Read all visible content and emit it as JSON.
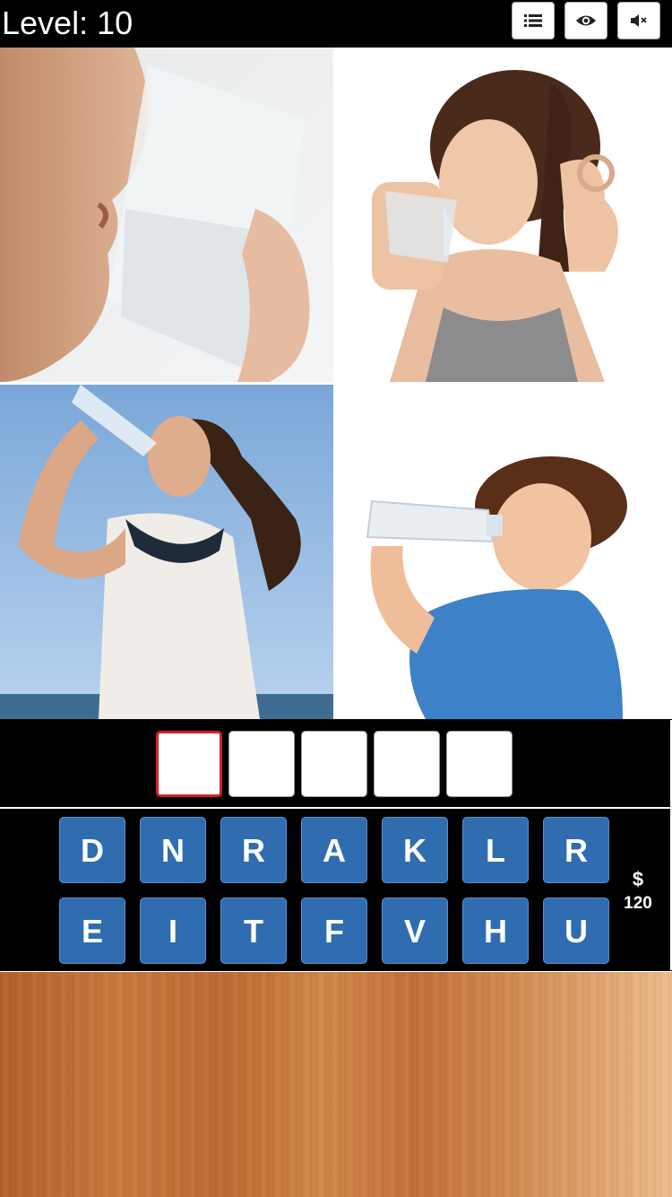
{
  "header": {
    "level_text": "Level: 10",
    "buttons": [
      {
        "icon": "list-icon"
      },
      {
        "icon": "eye-icon"
      },
      {
        "icon": "mute-icon"
      }
    ]
  },
  "photos": [
    {
      "subject": "close-up person drinking from glass"
    },
    {
      "subject": "woman drinking water making ok sign"
    },
    {
      "subject": "woman drinking from bottle"
    },
    {
      "subject": "boy drinking from bottle"
    }
  ],
  "answer": {
    "slot_count": 5,
    "active_slot": 0
  },
  "keyboard": {
    "row1": [
      "D",
      "N",
      "R",
      "A",
      "K",
      "L",
      "R"
    ],
    "row2": [
      "E",
      "I",
      "T",
      "F",
      "V",
      "H",
      "U"
    ]
  },
  "coins": {
    "symbol": "$",
    "amount": "120"
  },
  "colors": {
    "key_blue": "#2f6db0",
    "active_slot_border": "#d81e1e",
    "background": "#000000"
  }
}
